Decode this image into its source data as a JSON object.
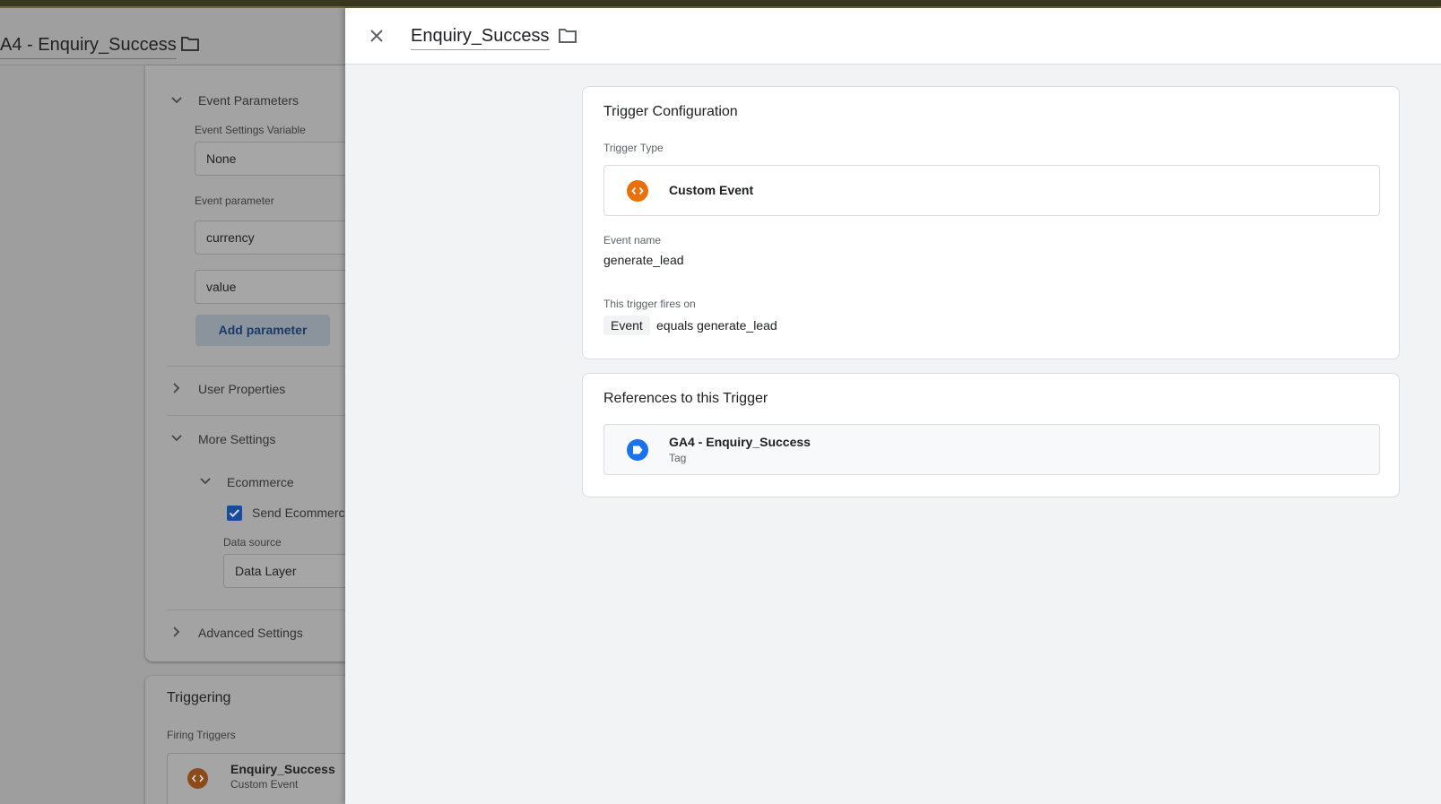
{
  "background_panel": {
    "title": "A4 - Enquiry_Success",
    "event_parameters": {
      "heading": "Event Parameters",
      "settings_variable_label": "Event Settings Variable",
      "settings_variable_value": "None",
      "parameter_label": "Event parameter",
      "parameters": [
        "currency",
        "value"
      ],
      "add_button": "Add parameter"
    },
    "user_properties": "User Properties",
    "more_settings": "More Settings",
    "ecommerce": {
      "heading": "Ecommerce",
      "checkbox_label": "Send Ecommerce",
      "checkbox_checked": true,
      "data_source_label": "Data source",
      "data_source_value": "Data Layer"
    },
    "advanced_settings": "Advanced Settings",
    "triggering": {
      "heading": "Triggering",
      "firing_label": "Firing Triggers",
      "trigger_name": "Enquiry_Success",
      "trigger_type": "Custom Event"
    }
  },
  "drawer": {
    "title": "Enquiry_Success",
    "close_icon": "close-icon",
    "folder_icon": "folder-icon",
    "trigger_configuration": {
      "heading": "Trigger Configuration",
      "type_label": "Trigger Type",
      "type_name": "Custom Event",
      "type_icon": "custom-event-icon",
      "event_name_label": "Event name",
      "event_name_value": "generate_lead",
      "fires_on_label": "This trigger fires on",
      "condition_variable": "Event",
      "condition_text": "equals generate_lead"
    },
    "references": {
      "heading": "References to this Trigger",
      "items": [
        {
          "name": "GA4 - Enquiry_Success",
          "kind": "Tag",
          "icon": "tag-icon"
        }
      ]
    }
  },
  "colors": {
    "custom_event_orange": "#e8710a",
    "tag_blue": "#1a73e8",
    "dim_background": "#9e9e9e"
  }
}
